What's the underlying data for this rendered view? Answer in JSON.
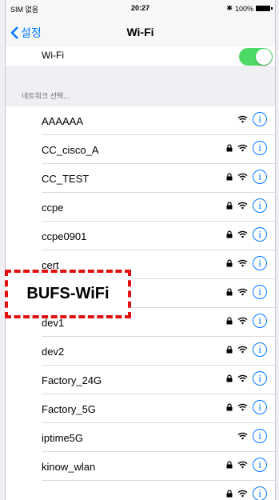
{
  "status_bar": {
    "carrier": "SIM 없음",
    "time": "20:27",
    "battery": "100%"
  },
  "nav": {
    "back_label": "설정",
    "title": "Wi-Fi"
  },
  "wifi_toggle": {
    "label": "Wi-Fi",
    "on": true
  },
  "section_header": "네트워크 선택...",
  "networks": [
    {
      "name": "AAAAAA",
      "locked": false
    },
    {
      "name": "CC_cisco_A",
      "locked": true
    },
    {
      "name": "CC_TEST",
      "locked": true
    },
    {
      "name": "ccpe",
      "locked": true
    },
    {
      "name": "ccpe0901",
      "locked": true
    },
    {
      "name": "cert",
      "locked": true
    },
    {
      "name": "",
      "locked": true
    },
    {
      "name": "dev1",
      "locked": true
    },
    {
      "name": "dev2",
      "locked": true
    },
    {
      "name": "Factory_24G",
      "locked": true
    },
    {
      "name": "Factory_5G",
      "locked": true
    },
    {
      "name": "iptime5G",
      "locked": false
    },
    {
      "name": "kinow_wlan",
      "locked": true
    },
    {
      "name": "",
      "locked": true
    }
  ],
  "annotation": {
    "label": "BUFS-WiFi",
    "color": "#e01010"
  },
  "colors": {
    "accent": "#007aff",
    "toggle_on": "#4cd964"
  },
  "info_glyph": "i"
}
